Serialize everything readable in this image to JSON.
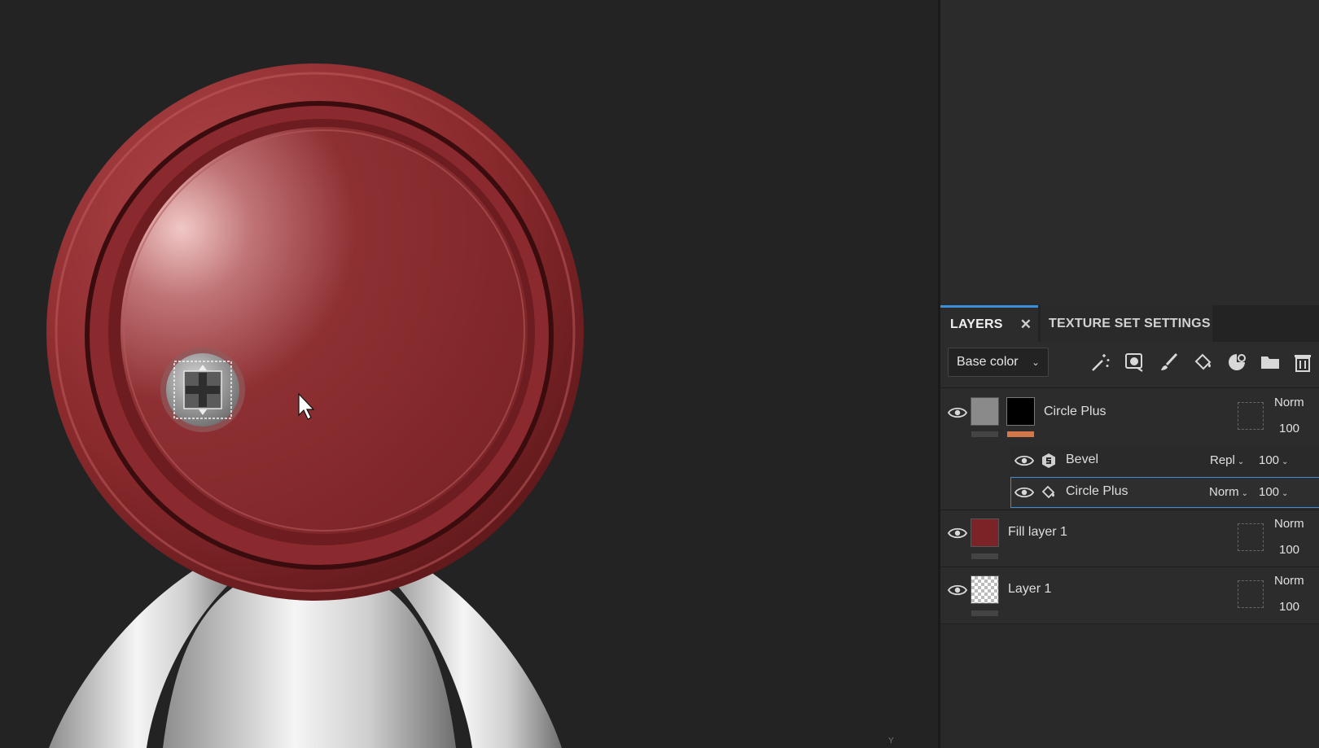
{
  "viewport": {
    "axis_label": "Y"
  },
  "panel": {
    "tabs": [
      {
        "label": "LAYERS",
        "active": true
      },
      {
        "label": "TEXTURE SET SETTINGS",
        "active": false
      }
    ],
    "toolbar": {
      "channel": "Base color",
      "icons": [
        "magic-wand-icon",
        "smart-mask-icon",
        "paint-layer-icon",
        "fill-layer-icon",
        "mask-generator-icon",
        "folder-icon",
        "trash-icon"
      ]
    },
    "layers": [
      {
        "name": "Circle Plus",
        "blend": "Norm",
        "opacity": "100",
        "effects": [
          {
            "name": "Bevel",
            "blend": "Repl",
            "opacity": "100",
            "icon": "substance-filter-icon"
          },
          {
            "name": "Circle Plus",
            "blend": "Norm",
            "opacity": "100",
            "icon": "fill-bucket-icon",
            "selected": true
          }
        ]
      },
      {
        "name": "Fill layer 1",
        "blend": "Norm",
        "opacity": "100"
      },
      {
        "name": "Layer 1",
        "blend": "Norm",
        "opacity": "100"
      }
    ]
  },
  "colors": {
    "accent": "#3b8fd8",
    "material_red": "#8a2b2e",
    "orange_tag": "#d4784b"
  }
}
